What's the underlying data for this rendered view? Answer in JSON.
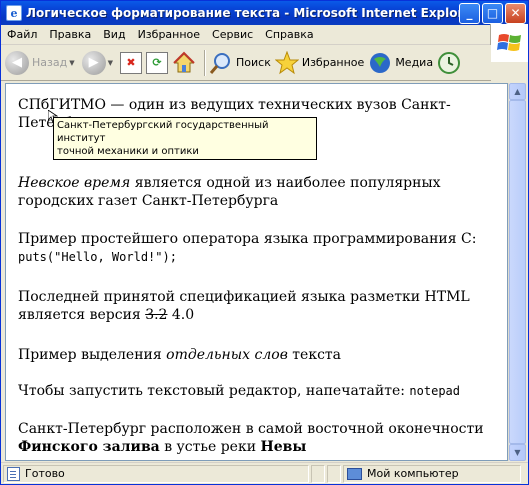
{
  "window": {
    "title": "Логическое форматирование текста - Microsoft Internet Explorer",
    "minimize_glyph": "_",
    "maximize_glyph": "□",
    "close_glyph": "✕"
  },
  "menu": {
    "items": [
      "Файл",
      "Правка",
      "Вид",
      "Избранное",
      "Сервис",
      "Справка"
    ]
  },
  "toolbar": {
    "back_label": "Назад",
    "search_label": "Поиск",
    "favorites_label": "Избранное",
    "media_label": "Медиа",
    "icons": [
      "back-arrow-icon",
      "forward-arrow-icon",
      "stop-icon",
      "refresh-icon",
      "home-icon",
      "search-icon",
      "favorites-star-icon",
      "media-icon",
      "history-icon"
    ]
  },
  "content": {
    "p1": "СПбГИТМО — один из ведущих технических вузов Санкт-Петербурга",
    "tooltip_line1": "Санкт-Петербургский государственный институт",
    "tooltip_line2": "точной механики и оптики",
    "p2_em": "Невское время",
    "p2_rest": " является одной из наиболее популярных городских газет Санкт-Петербурга",
    "p3_text": "Пример простейшего оператора языка программирования С:",
    "p3_code": "puts(\"Hello, World!\");",
    "p4_text": "Последней принятой спецификацией языка разметки HTML является версия ",
    "p4_del": "3.2",
    "p4_ins": " 4.0",
    "p5_before": "Пример выделения ",
    "p5_em": "отдельных слов",
    "p5_after": " текста",
    "p6_text": "Чтобы запустить текстовый редактор, напечатайте: ",
    "p6_kbd": "notepad",
    "p7_text": "Санкт-Петербург расположен в самой восточной оконечности ",
    "p7_strong1": "Финского залива",
    "p7_mid": " в устье реки ",
    "p7_strong2": "Невы"
  },
  "status": {
    "left_text": "Готово",
    "zone_text": "Мой компьютер"
  },
  "colors": {
    "titlebar": "#0846d8",
    "window_bg": "#ece9d8",
    "tooltip_bg": "#ffffe1"
  }
}
